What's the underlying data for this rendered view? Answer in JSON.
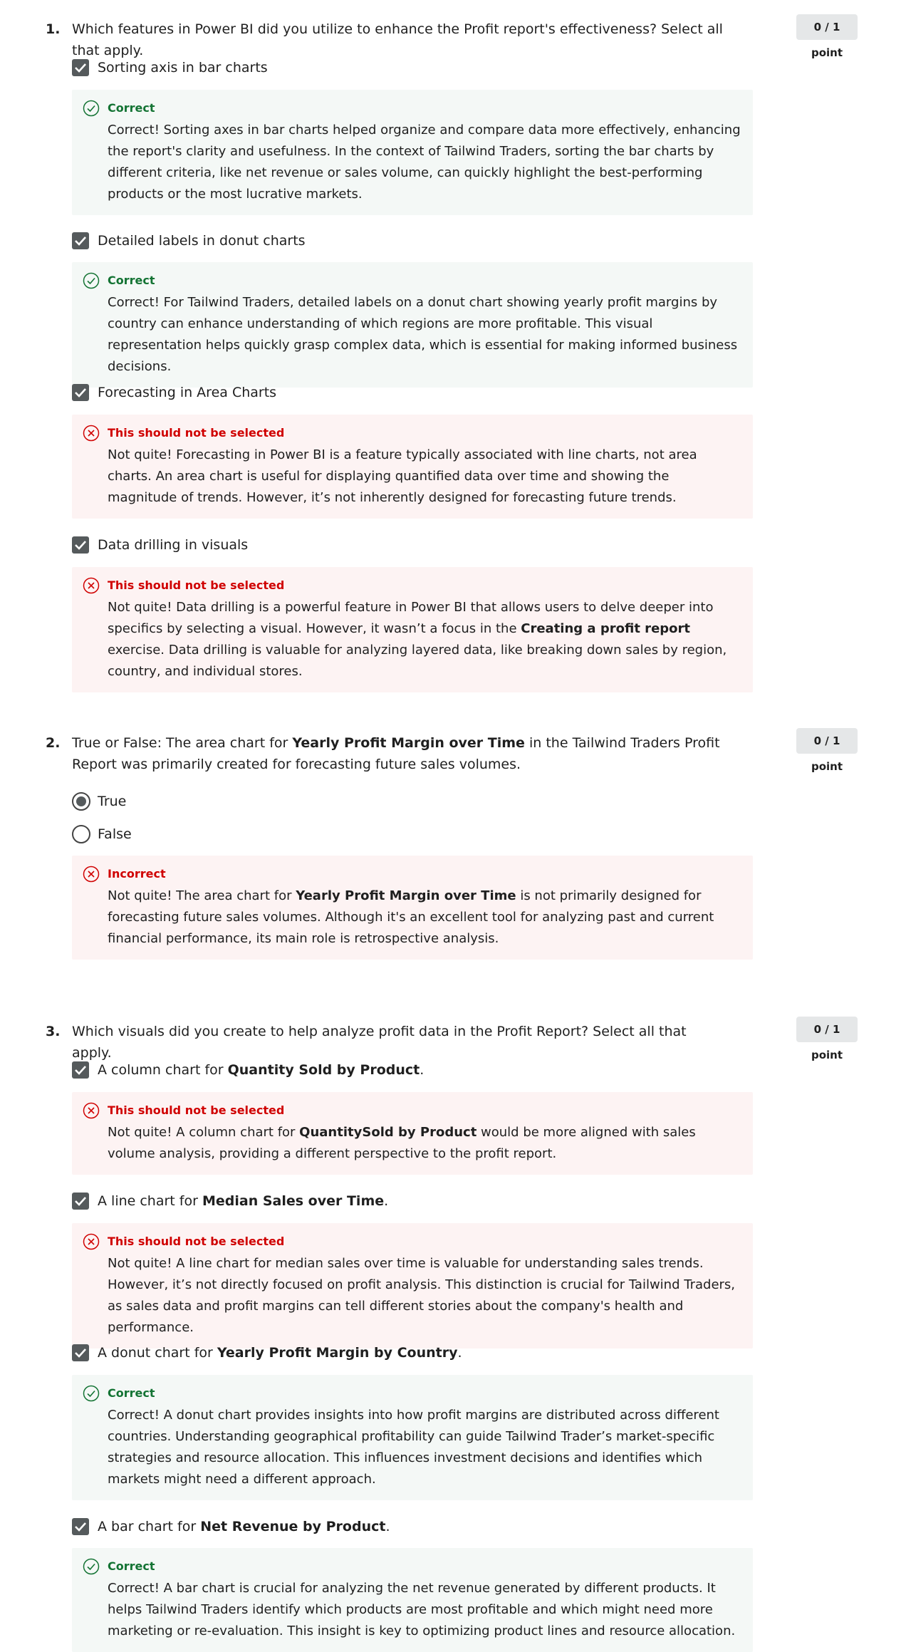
{
  "questions": [
    {
      "number": "1.",
      "text_parts": [
        "Which features in Power BI did you utilize to enhance the Profit report's effectiveness? Select all that apply."
      ],
      "score": "0 / 1 point",
      "type": "checkbox",
      "options": [
        {
          "label": [
            "Sorting axis in bar charts"
          ],
          "checked": true,
          "feedback": {
            "kind": "correct",
            "status": "Correct",
            "text": [
              "Correct! Sorting axes in bar charts helped organize and compare data more effectively, enhancing the report's clarity and usefulness. In the context of Tailwind Traders, sorting the bar charts by different criteria, like net revenue or sales volume, can quickly highlight the best-performing products or the most lucrative markets."
            ]
          }
        },
        {
          "label": [
            "Detailed labels in donut charts"
          ],
          "checked": true,
          "feedback": {
            "kind": "correct",
            "status": "Correct",
            "text": [
              "Correct! For Tailwind Traders, detailed labels on a donut chart showing yearly profit margins by country can enhance understanding of which regions are more profitable. This visual representation helps quickly grasp complex data, which is essential for making informed business decisions."
            ]
          }
        },
        {
          "label": [
            "Forecasting in Area Charts"
          ],
          "checked": true,
          "feedback": {
            "kind": "wrong",
            "status": "This should not be selected",
            "text": [
              "Not quite! Forecasting in Power BI is a feature typically associated with line charts, not area charts. An area chart is useful for displaying quantified data over time and showing the magnitude of trends. However, it’s not inherently designed for forecasting future trends."
            ]
          }
        },
        {
          "label": [
            "Data drilling in visuals"
          ],
          "checked": true,
          "feedback": {
            "kind": "wrong",
            "status": "This should not be selected",
            "text": [
              "Not quite! Data drilling is a powerful feature in Power BI that allows users to delve deeper into specifics by selecting a visual. However, it wasn’t a focus in the ",
              "Creating a profit report",
              " exercise. Data drilling is valuable for analyzing layered data, like breaking down sales by region, country, and individual stores."
            ]
          }
        }
      ]
    },
    {
      "number": "2.",
      "text_parts": [
        "True or False: The area chart for ",
        "Yearly Profit Margin over Time",
        " in the Tailwind Traders Profit Report was primarily created for forecasting future sales volumes."
      ],
      "score": "0 / 1 point",
      "type": "radio",
      "options": [
        {
          "label": [
            "True"
          ],
          "checked": true
        },
        {
          "label": [
            "False"
          ],
          "checked": false
        }
      ],
      "feedback": {
        "kind": "wrong",
        "status": "Incorrect",
        "text": [
          "Not quite! The area chart for ",
          "Yearly Profit Margin over Time",
          " is not primarily designed for forecasting future sales volumes. Although it's an excellent tool for analyzing past and current financial performance, its main role is retrospective analysis."
        ]
      }
    },
    {
      "number": "3.",
      "text_parts": [
        "Which visuals did you create to help analyze profit data in the Profit Report? Select all that apply."
      ],
      "score": "0 / 1 point",
      "type": "checkbox",
      "options": [
        {
          "label": [
            "A column chart for ",
            "Quantity Sold by Product",
            "."
          ],
          "checked": true,
          "feedback": {
            "kind": "wrong",
            "status": "This should not be selected",
            "text": [
              "Not quite! A column chart for ",
              "QuantitySold by Product",
              " would be more aligned with sales volume analysis, providing a different perspective to the profit report."
            ]
          }
        },
        {
          "label": [
            "A line chart for ",
            "Median Sales over Time",
            "."
          ],
          "checked": true,
          "feedback": {
            "kind": "wrong",
            "status": "This should not be selected",
            "text": [
              "Not quite! A line chart for median sales over time is valuable for understanding sales trends. However, it’s not directly focused on profit analysis. This distinction is crucial for Tailwind Traders, as sales data and profit margins can tell different stories about the company's health and performance."
            ]
          }
        },
        {
          "label": [
            "A donut chart for ",
            "Yearly Profit Margin by Country",
            "."
          ],
          "checked": true,
          "feedback": {
            "kind": "correct",
            "status": "Correct",
            "text": [
              "Correct! A donut chart provides insights into how profit margins are distributed across different countries. Understanding geographical profitability can guide Tailwind Trader’s market-specific strategies and resource allocation. This influences investment decisions and identifies which markets might need a different approach."
            ]
          }
        },
        {
          "label": [
            "A bar chart for ",
            "Net Revenue by Product",
            "."
          ],
          "checked": true,
          "feedback": {
            "kind": "correct",
            "status": "Correct",
            "text": [
              "Correct! A bar chart is crucial for analyzing the net revenue generated by different products. It helps Tailwind Traders identify which products are most profitable and which might need more marketing or re-evaluation. This insight is key to optimizing product lines and resource allocation."
            ]
          }
        }
      ]
    }
  ]
}
